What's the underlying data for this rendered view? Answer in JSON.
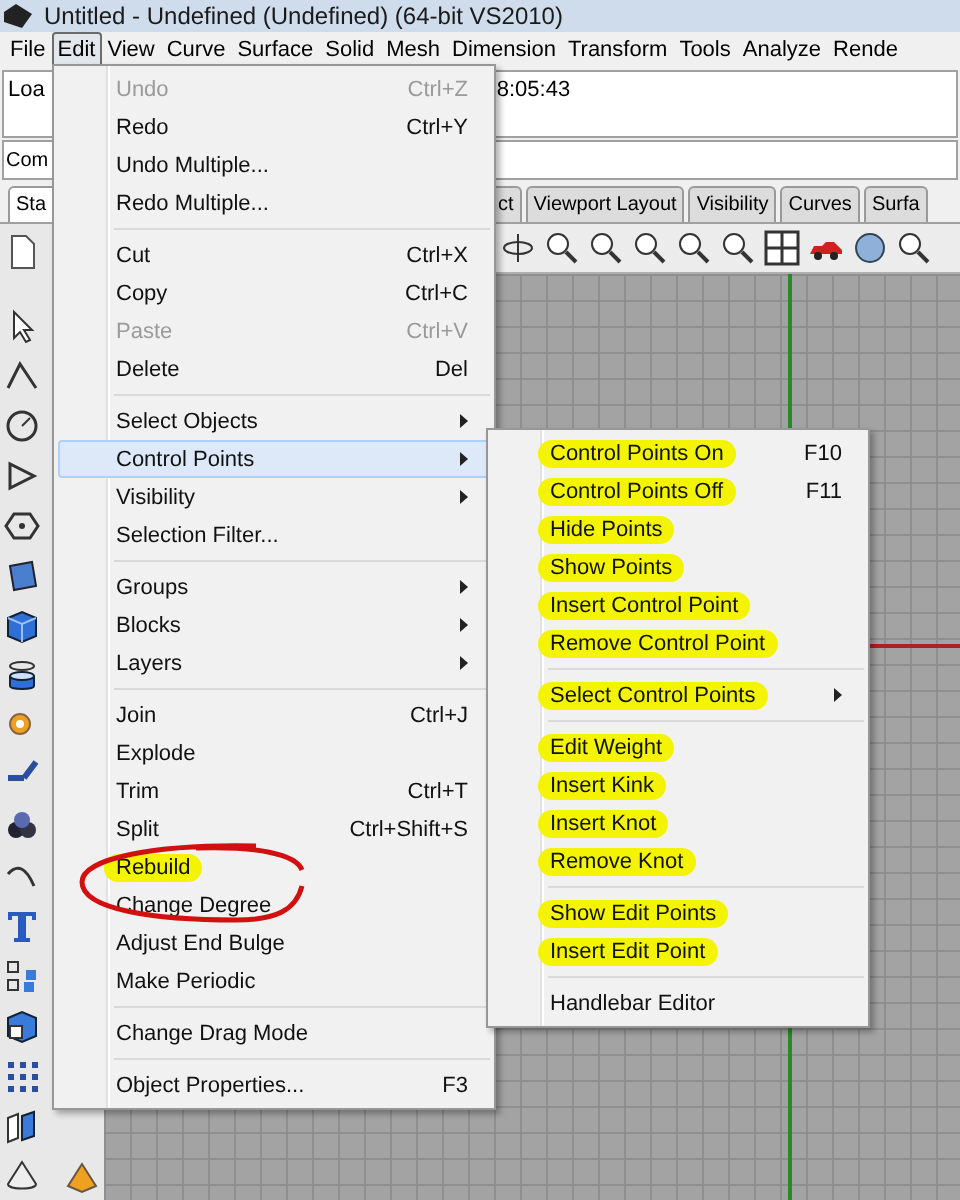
{
  "window": {
    "title": "Untitled - Undefined (Undefined) (64-bit VS2010)"
  },
  "menubar": [
    {
      "label": "File",
      "selected": false
    },
    {
      "label": "Edit",
      "selected": true
    },
    {
      "label": "View",
      "selected": false
    },
    {
      "label": "Curve",
      "selected": false
    },
    {
      "label": "Surface",
      "selected": false
    },
    {
      "label": "Solid",
      "selected": false
    },
    {
      "label": "Mesh",
      "selected": false
    },
    {
      "label": "Dimension",
      "selected": false
    },
    {
      "label": "Transform",
      "selected": false
    },
    {
      "label": "Tools",
      "selected": false
    },
    {
      "label": "Analyze",
      "selected": false
    },
    {
      "label": "Rende",
      "selected": false
    }
  ],
  "command_history": {
    "line_start": "Loa",
    "time": "8:05:43"
  },
  "command_prompt": "Com",
  "toolbar_tabs": [
    {
      "label": "Sta",
      "selected": true
    },
    {
      "label": "ct",
      "selected": false
    },
    {
      "label": "Viewport Layout",
      "selected": false
    },
    {
      "label": "Visibility",
      "selected": false
    },
    {
      "label": "Curves",
      "selected": false
    },
    {
      "label": "Surfa",
      "selected": false
    }
  ],
  "edit_menu": [
    {
      "kind": "item",
      "label": "Undo",
      "shortcut": "Ctrl+Z",
      "disabled": true,
      "submenu": false,
      "selected": false,
      "highlighted": false
    },
    {
      "kind": "item",
      "label": "Redo",
      "shortcut": "Ctrl+Y",
      "disabled": false,
      "submenu": false,
      "selected": false,
      "highlighted": false
    },
    {
      "kind": "item",
      "label": "Undo Multiple...",
      "disabled": false,
      "submenu": false,
      "selected": false,
      "highlighted": false
    },
    {
      "kind": "item",
      "label": "Redo Multiple...",
      "disabled": false,
      "submenu": false,
      "selected": false,
      "highlighted": false
    },
    {
      "kind": "separator"
    },
    {
      "kind": "item",
      "label": "Cut",
      "shortcut": "Ctrl+X",
      "disabled": false,
      "submenu": false,
      "selected": false,
      "highlighted": false
    },
    {
      "kind": "item",
      "label": "Copy",
      "shortcut": "Ctrl+C",
      "disabled": false,
      "submenu": false,
      "selected": false,
      "highlighted": false
    },
    {
      "kind": "item",
      "label": "Paste",
      "shortcut": "Ctrl+V",
      "disabled": true,
      "submenu": false,
      "selected": false,
      "highlighted": false
    },
    {
      "kind": "item",
      "label": "Delete",
      "shortcut": "Del",
      "disabled": false,
      "submenu": false,
      "selected": false,
      "highlighted": false
    },
    {
      "kind": "separator"
    },
    {
      "kind": "item",
      "label": "Select Objects",
      "disabled": false,
      "submenu": true,
      "selected": false,
      "highlighted": false
    },
    {
      "kind": "item",
      "label": "Control Points",
      "disabled": false,
      "submenu": true,
      "selected": true,
      "highlighted": false
    },
    {
      "kind": "item",
      "label": "Visibility",
      "disabled": false,
      "submenu": true,
      "selected": false,
      "highlighted": false
    },
    {
      "kind": "item",
      "label": "Selection Filter...",
      "disabled": false,
      "submenu": false,
      "selected": false,
      "highlighted": false
    },
    {
      "kind": "separator"
    },
    {
      "kind": "item",
      "label": "Groups",
      "disabled": false,
      "submenu": true,
      "selected": false,
      "highlighted": false
    },
    {
      "kind": "item",
      "label": "Blocks",
      "disabled": false,
      "submenu": true,
      "selected": false,
      "highlighted": false
    },
    {
      "kind": "item",
      "label": "Layers",
      "disabled": false,
      "submenu": true,
      "selected": false,
      "highlighted": false
    },
    {
      "kind": "separator"
    },
    {
      "kind": "item",
      "label": "Join",
      "shortcut": "Ctrl+J",
      "disabled": false,
      "submenu": false,
      "selected": false,
      "highlighted": false
    },
    {
      "kind": "item",
      "label": "Explode",
      "disabled": false,
      "submenu": false,
      "selected": false,
      "highlighted": false
    },
    {
      "kind": "item",
      "label": "Trim",
      "shortcut": "Ctrl+T",
      "disabled": false,
      "submenu": false,
      "selected": false,
      "highlighted": false
    },
    {
      "kind": "item",
      "label": "Split",
      "shortcut": "Ctrl+Shift+S",
      "disabled": false,
      "submenu": false,
      "selected": false,
      "highlighted": false
    },
    {
      "kind": "item",
      "label": "Rebuild",
      "disabled": false,
      "submenu": false,
      "selected": false,
      "highlighted": true
    },
    {
      "kind": "item",
      "label": "Change Degree",
      "disabled": false,
      "submenu": false,
      "selected": false,
      "highlighted": false
    },
    {
      "kind": "item",
      "label": "Adjust End Bulge",
      "disabled": false,
      "submenu": false,
      "selected": false,
      "highlighted": false
    },
    {
      "kind": "item",
      "label": "Make Periodic",
      "disabled": false,
      "submenu": false,
      "selected": false,
      "highlighted": false
    },
    {
      "kind": "separator"
    },
    {
      "kind": "item",
      "label": "Change Drag Mode",
      "disabled": false,
      "submenu": false,
      "selected": false,
      "highlighted": false
    },
    {
      "kind": "separator"
    },
    {
      "kind": "item",
      "label": "Object Properties...",
      "shortcut": "F3",
      "disabled": false,
      "submenu": false,
      "selected": false,
      "highlighted": false
    }
  ],
  "control_points_menu": [
    {
      "kind": "item",
      "label": "Control Points On",
      "shortcut": "F10",
      "disabled": false,
      "submenu": false,
      "selected": false,
      "highlighted": true
    },
    {
      "kind": "item",
      "label": "Control Points Off",
      "shortcut": "F11",
      "disabled": false,
      "submenu": false,
      "selected": false,
      "highlighted": true
    },
    {
      "kind": "item",
      "label": "Hide Points",
      "disabled": false,
      "submenu": false,
      "selected": false,
      "highlighted": true
    },
    {
      "kind": "item",
      "label": "Show Points",
      "disabled": false,
      "submenu": false,
      "selected": false,
      "highlighted": true
    },
    {
      "kind": "item",
      "label": "Insert Control Point",
      "disabled": false,
      "submenu": false,
      "selected": false,
      "highlighted": true
    },
    {
      "kind": "item",
      "label": "Remove Control Point",
      "disabled": false,
      "submenu": false,
      "selected": false,
      "highlighted": true
    },
    {
      "kind": "separator"
    },
    {
      "kind": "item",
      "label": "Select Control Points",
      "disabled": false,
      "submenu": true,
      "selected": false,
      "highlighted": true
    },
    {
      "kind": "separator"
    },
    {
      "kind": "item",
      "label": "Edit Weight",
      "disabled": false,
      "submenu": false,
      "selected": false,
      "highlighted": true
    },
    {
      "kind": "item",
      "label": "Insert Kink",
      "disabled": false,
      "submenu": false,
      "selected": false,
      "highlighted": true
    },
    {
      "kind": "item",
      "label": "Insert Knot",
      "disabled": false,
      "submenu": false,
      "selected": false,
      "highlighted": true
    },
    {
      "kind": "item",
      "label": "Remove Knot",
      "disabled": false,
      "submenu": false,
      "selected": false,
      "highlighted": true
    },
    {
      "kind": "separator"
    },
    {
      "kind": "item",
      "label": "Show Edit Points",
      "disabled": false,
      "submenu": false,
      "selected": false,
      "highlighted": true
    },
    {
      "kind": "item",
      "label": "Insert Edit Point",
      "disabled": false,
      "submenu": false,
      "selected": false,
      "highlighted": true
    },
    {
      "kind": "separator"
    },
    {
      "kind": "item",
      "label": "Handlebar Editor",
      "disabled": false,
      "submenu": false,
      "selected": false,
      "highlighted": false
    }
  ]
}
